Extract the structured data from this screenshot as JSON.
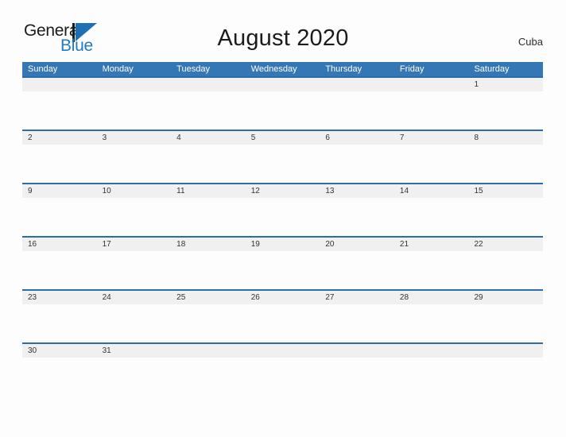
{
  "brand": {
    "word_one": "General",
    "word_two": "Blue",
    "mark_icon": "triangle-flag-icon",
    "accent_color": "#1f7ac4"
  },
  "header": {
    "title": "August 2020",
    "region": "Cuba"
  },
  "theme": {
    "header_blue": "#3576b4",
    "rule_blue": "#2e6da4",
    "band_gray": "#f0f0f0",
    "page_bg": "#fdfdfd",
    "date_text": "#333333"
  },
  "calendar": {
    "month": "August",
    "year": "2020",
    "day_headers": [
      "Sunday",
      "Monday",
      "Tuesday",
      "Wednesday",
      "Thursday",
      "Friday",
      "Saturday"
    ],
    "weeks": [
      {
        "days": [
          "",
          "",
          "",
          "",
          "",
          "",
          "1"
        ]
      },
      {
        "days": [
          "2",
          "3",
          "4",
          "5",
          "6",
          "7",
          "8"
        ]
      },
      {
        "days": [
          "9",
          "10",
          "11",
          "12",
          "13",
          "14",
          "15"
        ]
      },
      {
        "days": [
          "16",
          "17",
          "18",
          "19",
          "20",
          "21",
          "22"
        ]
      },
      {
        "days": [
          "23",
          "24",
          "25",
          "26",
          "27",
          "28",
          "29"
        ]
      },
      {
        "days": [
          "30",
          "31",
          "",
          "",
          "",
          "",
          ""
        ]
      }
    ]
  }
}
